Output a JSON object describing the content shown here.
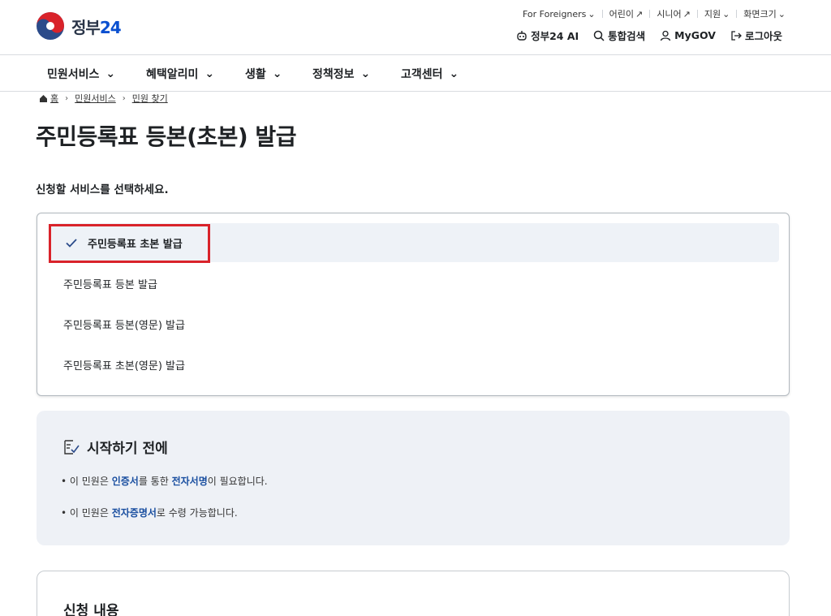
{
  "header": {
    "logo_text": "정부",
    "logo_num": "24",
    "util": [
      {
        "label": "For Foreigners",
        "icon": "chevron-down-icon"
      },
      {
        "label": "어린이",
        "icon": "external-link-icon"
      },
      {
        "label": "시니어",
        "icon": "external-link-icon"
      },
      {
        "label": "지원",
        "icon": "chevron-down-icon"
      },
      {
        "label": "화면크기",
        "icon": "chevron-down-icon"
      }
    ],
    "main_util": [
      {
        "label": "정부24 AI",
        "icon": "ai-bot-icon"
      },
      {
        "label": "통합검색",
        "icon": "search-icon"
      },
      {
        "label": "MyGOV",
        "icon": "user-icon"
      },
      {
        "label": "로그아웃",
        "icon": "logout-icon"
      }
    ]
  },
  "gnb": [
    "민원서비스",
    "혜택알리미",
    "생활",
    "정책정보",
    "고객센터"
  ],
  "breadcrumb": [
    "홈",
    "민원서비스",
    "민원 찾기"
  ],
  "page_title": "주민등록표 등본(초본) 발급",
  "sub_heading": "신청할 서비스를 선택하세요.",
  "options": [
    {
      "label": "주민등록표 초본 발급",
      "selected": true
    },
    {
      "label": "주민등록표 등본 발급",
      "selected": false
    },
    {
      "label": "주민등록표 등본(영문) 발급",
      "selected": false
    },
    {
      "label": "주민등록표 초본(영문) 발급",
      "selected": false
    }
  ],
  "info": {
    "title": "시작하기 전에",
    "line1": {
      "bullet": "•",
      "pre": "이 민원은 ",
      "b1": "인증서",
      "mid": "를 통한 ",
      "b2": "전자서명",
      "post": "이 필요합니다."
    },
    "line2": {
      "bullet": "•",
      "pre": "이 민원은 ",
      "b1": "전자증명서",
      "post": "로 수령 가능합니다."
    }
  },
  "apply": {
    "title": "신청 내용"
  },
  "colors": {
    "accent": "#0b50d0",
    "highlight": "#d9232a",
    "info_bg": "#eef1f6",
    "selected_bg": "#eef2f7",
    "link_bold": "#1a4fa0"
  }
}
